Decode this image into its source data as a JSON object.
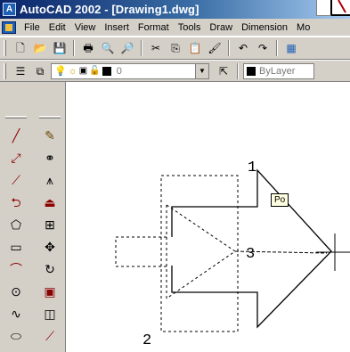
{
  "window": {
    "title": "AutoCAD 2002 - [Drawing1.dwg]",
    "app_icon_glyph": "A"
  },
  "menubar": {
    "items": [
      "File",
      "Edit",
      "View",
      "Insert",
      "Format",
      "Tools",
      "Draw",
      "Dimension",
      "Mo"
    ]
  },
  "toolbars": {
    "standard_icons": [
      "new-icon",
      "open-icon",
      "save-icon",
      "print-icon",
      "print-preview-icon",
      "find-icon",
      "cut-icon",
      "copy-icon",
      "paste-icon",
      "match-properties-icon",
      "undo-icon",
      "redo-icon",
      "design-center-icon"
    ],
    "layers": {
      "current_layer": "0",
      "color_value": "ByLayer"
    }
  },
  "draw_tools": [
    "line-icon",
    "construction-line-icon",
    "polyline-icon",
    "polygon-icon",
    "rectangle-icon",
    "arc-icon",
    "circle-icon",
    "spline-icon",
    "ellipse-icon",
    "ellipse-arc-icon"
  ],
  "modify_tools": [
    "erase-icon",
    "copy-object-icon",
    "mirror-icon",
    "offset-icon",
    "array-icon",
    "move-icon",
    "rotate-icon",
    "scale-icon",
    "stretch-icon",
    "trim-icon"
  ],
  "drawing": {
    "label_1": "1",
    "label_2": "2",
    "label_3": "3",
    "tooltip": "Po"
  },
  "colors": {
    "title_start": "#0a246a",
    "title_end": "#a6caf0",
    "chrome": "#d4d0c8",
    "canvas": "#ffffff"
  }
}
